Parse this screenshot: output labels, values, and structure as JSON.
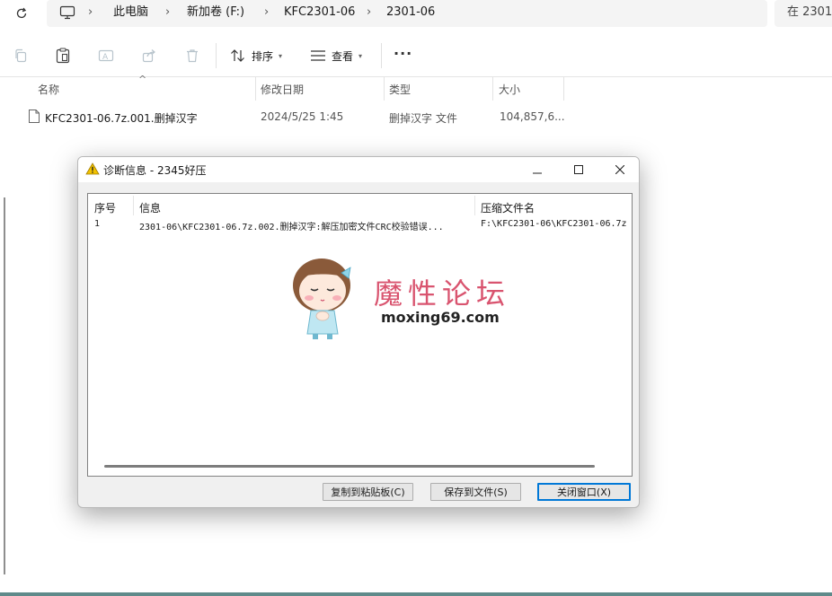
{
  "addressbar": {
    "crumbs": [
      "此电脑",
      "新加卷 (F:)",
      "KFC2301-06",
      "2301-06"
    ],
    "search_text": "在 2301"
  },
  "commandbar": {
    "sort_label": "排序",
    "view_label": "查看",
    "more_label": "···"
  },
  "filelist": {
    "columns": [
      "名称",
      "修改日期",
      "类型",
      "大小"
    ],
    "rows": [
      {
        "name": "KFC2301-06.7z.001.删掉汉字",
        "date": "2024/5/25 1:45",
        "type": "删掉汉字 文件",
        "size": "104,857,6..."
      }
    ]
  },
  "dialog": {
    "title": "诊断信息 - 2345好压",
    "columns": [
      "序号",
      "信息",
      "压缩文件名"
    ],
    "rows": [
      {
        "index": "1",
        "info": "2301-06\\KFC2301-06.7z.002.删掉汉字:解压加密文件CRC校验错误...",
        "archive": "F:\\KFC2301-06\\KFC2301-06.7z"
      }
    ],
    "buttons": {
      "copy": "复制到粘贴板(C)",
      "save": "保存到文件(S)",
      "close": "关闭窗口(X)"
    }
  },
  "watermark": {
    "title": "魔性论坛",
    "url": "moxing69.com"
  },
  "colors": {
    "accent": "#0078d7",
    "watermark_pink": "#d9546f",
    "warning_yellow": "#f2c200"
  }
}
